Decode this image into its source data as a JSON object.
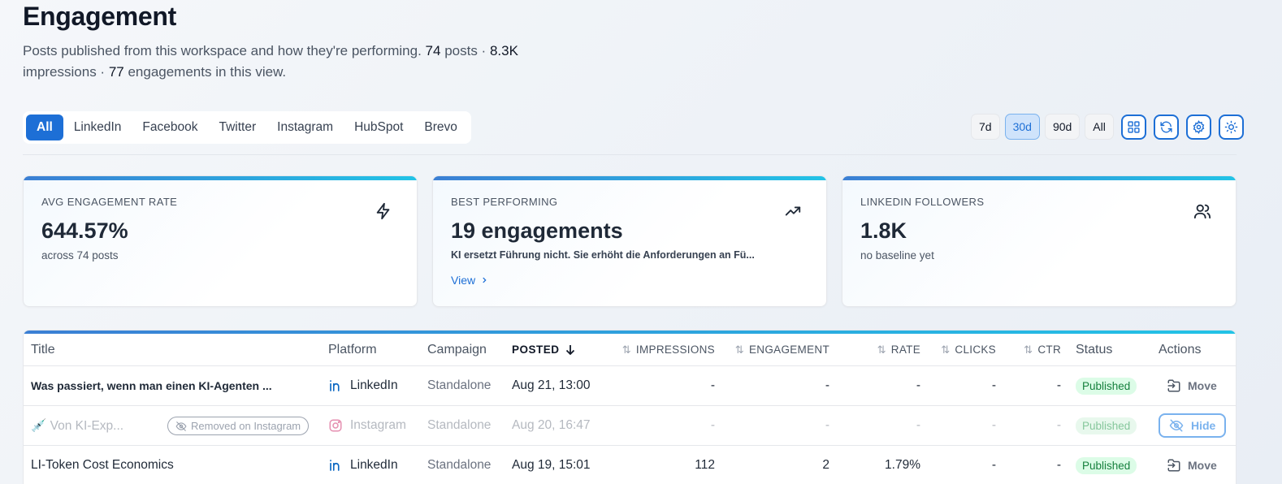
{
  "header": {
    "title": "Engagement",
    "subtitle_pre": "Posts published from this workspace and how they're performing. ",
    "posts_count": "74",
    "posts_word": " posts · ",
    "impressions_total": "8.3K",
    "impressions_word": " impressions · ",
    "engagements_total": "77",
    "engagements_word": " engagements in this view."
  },
  "platform_tabs": [
    "All",
    "LinkedIn",
    "Facebook",
    "Twitter",
    "Instagram",
    "HubSpot",
    "Brevo"
  ],
  "active_platform": "All",
  "ranges": [
    "7d",
    "30d",
    "90d",
    "All"
  ],
  "active_range": "30d",
  "toolbar_icons": [
    "grid-icon",
    "refresh-icon",
    "gear-icon",
    "sun-icon"
  ],
  "cards": [
    {
      "label": "AVG ENGAGEMENT RATE",
      "value": "644.57%",
      "sub": "across 74 posts",
      "icon": "lightning-icon"
    },
    {
      "label": "BEST PERFORMING",
      "value": "19 engagements",
      "sub": "KI ersetzt Führung nicht. Sie erhöht die Anforderungen an Fü...",
      "link": "View",
      "icon": "trending-up-icon"
    },
    {
      "label": "LINKEDIN FOLLOWERS",
      "value": "1.8K",
      "sub": "no baseline yet",
      "icon": "users-icon"
    }
  ],
  "table": {
    "headers": {
      "title": "Title",
      "platform": "Platform",
      "campaign": "Campaign",
      "posted": "POSTED",
      "impressions": "IMPRESSIONS",
      "engagement": "ENGAGEMENT",
      "rate": "RATE",
      "clicks": "CLICKS",
      "ctr": "CTR",
      "status": "Status",
      "actions": "Actions"
    },
    "rows": [
      {
        "title": "Was passiert, wenn man einen KI-Agenten ...",
        "platform": "LinkedIn",
        "campaign": "Standalone",
        "posted": "Aug 21, 13:00",
        "impressions": "-",
        "engagement": "-",
        "rate": "-",
        "clicks": "-",
        "ctr": "-",
        "status": "Published",
        "action": "Move"
      },
      {
        "title": "💉 Von KI-Exp...",
        "removed": "Removed on Instagram",
        "platform": "Instagram",
        "campaign": "Standalone",
        "posted": "Aug 20, 16:47",
        "impressions": "-",
        "engagement": "-",
        "rate": "-",
        "clicks": "-",
        "ctr": "-",
        "status": "Published",
        "action": "Hide"
      },
      {
        "title": "LI-Token Cost Economics",
        "platform": "LinkedIn",
        "campaign": "Standalone",
        "posted": "Aug 19, 15:01",
        "impressions": "112",
        "engagement": "2",
        "rate": "1.79%",
        "clicks": "-",
        "ctr": "-",
        "status": "Published",
        "action": "Move"
      }
    ]
  }
}
